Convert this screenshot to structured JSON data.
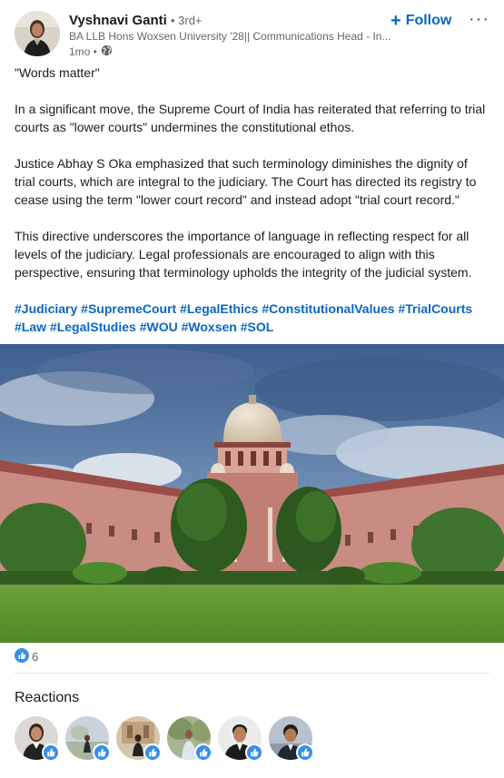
{
  "author": {
    "name": "Vyshnavi Ganti",
    "degree": "• 3rd+",
    "headline": "BA LLB Hons Woxsen University '28|| Communications Head - In...",
    "time": "1mo •",
    "visibility_icon": "globe-icon"
  },
  "actions": {
    "follow_label": "Follow",
    "more_label": "···"
  },
  "post": {
    "paragraphs": [
      "\"Words matter\"",
      "In a significant move, the Supreme Court of India has reiterated that referring to trial courts as \"lower courts\" undermines the constitutional ethos.",
      "Justice Abhay S Oka emphasized that such terminology diminishes the dignity of trial courts, which are integral to the judiciary. The Court has directed its registry to cease using the term \"lower court record\" and instead adopt \"trial court record.\"",
      "This directive underscores the importance of language in reflecting respect for all levels of the judiciary. Legal professionals are encouraged to align with this perspective, ensuring that terminology upholds the integrity of the judicial system."
    ],
    "hashtags": [
      "#Judiciary",
      "#SupremeCourt",
      "#LegalEthics",
      "#ConstitutionalValues",
      "#TrialCourts",
      "#Law",
      "#LegalStudies",
      "#WOU",
      "#Woxsen",
      "#SOL"
    ]
  },
  "social": {
    "reaction_icon": "like-icon",
    "count": "6"
  },
  "reactions": {
    "title": "Reactions"
  },
  "colors": {
    "accent": "#0a66c2",
    "like_badge": "#378fe9"
  }
}
